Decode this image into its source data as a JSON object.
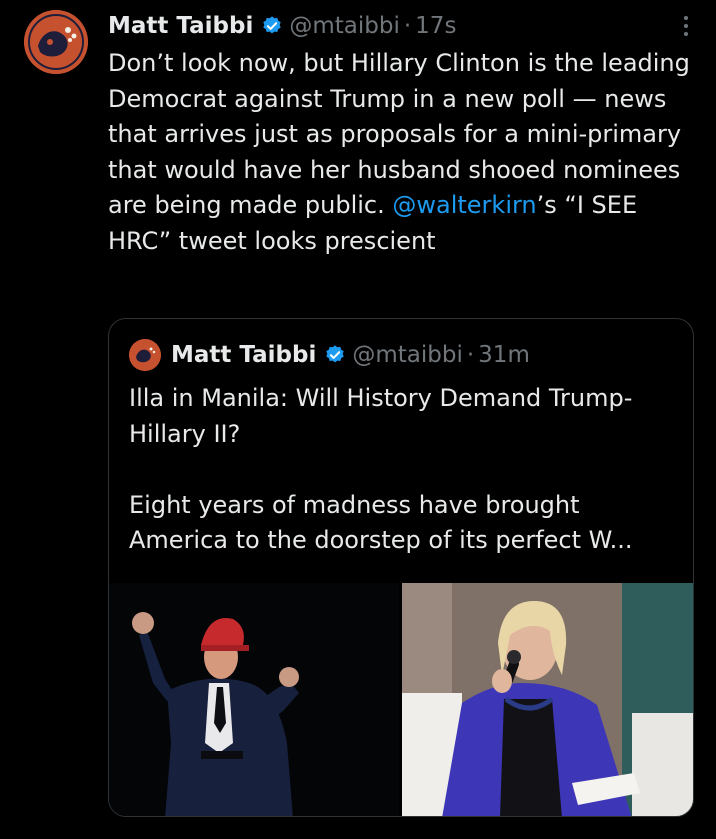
{
  "tweet": {
    "author_name": "Matt Taibbi",
    "handle": "@mtaibbi",
    "separator": "·",
    "time": "17s",
    "text_before": "Don’t look now, but Hillary Clinton is the leading Democrat against Trump in a new poll — news that arrives just as proposals for a mini-primary that would have her husband shooed nominees are being made public. ",
    "mention": "@walterkirn",
    "text_after": "’s “I SEE HRC” tweet looks prescient"
  },
  "quote": {
    "author_name": "Matt Taibbi",
    "handle": "@mtaibbi",
    "separator": "·",
    "time": "31m",
    "title": "Illa in Manila: Will History Demand Trump-Hillary II?",
    "excerpt": "Eight years of madness have brought America to the doorstep of its perfect W..."
  },
  "icons": {
    "verified": "verified-badge-icon",
    "more": "more-options-icon"
  },
  "colors": {
    "background": "#000000",
    "text": "#e7e9ea",
    "muted": "#71767b",
    "link": "#1d9bf0",
    "verified": "#1d9bf0",
    "avatar": "#c6512f"
  }
}
